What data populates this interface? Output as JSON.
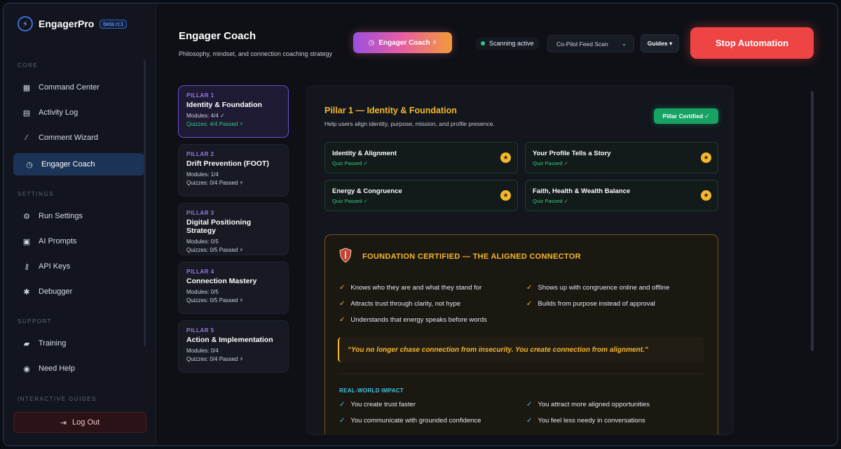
{
  "brand": {
    "name": "EngagerPro",
    "badge": "beta rc1"
  },
  "sidebar": {
    "sections": {
      "core": "CORE",
      "settings": "SETTINGS",
      "support": "SUPPORT",
      "guides": "INTERACTIVE GUIDES"
    },
    "items": [
      {
        "label": "Command Center",
        "icon": "grid-icon"
      },
      {
        "label": "Activity Log",
        "icon": "list-icon"
      },
      {
        "label": "Comment Wizard",
        "icon": "wand-icon"
      },
      {
        "label": "Engager Coach",
        "icon": "clock-icon",
        "active": true
      },
      {
        "label": "Run Settings",
        "icon": "gear-icon"
      },
      {
        "label": "AI Prompts",
        "icon": "chat-icon"
      },
      {
        "label": "API Keys",
        "icon": "key-icon"
      },
      {
        "label": "Debugger",
        "icon": "bug-icon"
      },
      {
        "label": "Training",
        "icon": "book-icon"
      },
      {
        "label": "Need Help",
        "icon": "help-icon"
      }
    ],
    "logout": "Log Out"
  },
  "header": {
    "title": "Engager Coach",
    "subtitle": "Philosophy, mindset, and connection coaching strategy",
    "coach_button": "Engager Coach ⚡",
    "status": "Scanning active",
    "feed_select": "Co-Pilot Feed Scan",
    "guides": "Guides ▾",
    "stop": "Stop Automation"
  },
  "pillars": [
    {
      "label": "PILLAR 1",
      "title": "Identity & Foundation",
      "modules": "Modules: 4/4 ✓",
      "quizzes": "Quizzes: 4/4 Passed ⚡",
      "active": true
    },
    {
      "label": "PILLAR 2",
      "title": "Drift Prevention (FOOT)",
      "modules": "Modules: 1/4",
      "quizzes": "Quizzes: 0/4 Passed ⚡"
    },
    {
      "label": "PILLAR 3",
      "title": "Digital Positioning Strategy",
      "modules": "Modules: 0/5",
      "quizzes": "Quizzes: 0/5 Passed ⚡"
    },
    {
      "label": "PILLAR 4",
      "title": "Connection Mastery",
      "modules": "Modules: 0/5",
      "quizzes": "Quizzes: 0/5 Passed ⚡"
    },
    {
      "label": "PILLAR 5",
      "title": "Action & Implementation",
      "modules": "Modules: 0/4",
      "quizzes": "Quizzes: 0/4 Passed ⚡"
    }
  ],
  "main": {
    "title": "Pillar 1 — Identity & Foundation",
    "subtitle": "Help users align identity, purpose, mission, and profile presence.",
    "badge": "Pillar Certified ✓",
    "quizzes": [
      {
        "title": "Identity & Alignment",
        "status": "Quiz Passed ✓"
      },
      {
        "title": "Your Profile Tells a Story",
        "status": "Quiz Passed ✓"
      },
      {
        "title": "Energy & Congruence",
        "status": "Quiz Passed ✓"
      },
      {
        "title": "Faith, Health & Wealth Balance",
        "status": "Quiz Passed ✓"
      }
    ],
    "foundation": {
      "title": "FOUNDATION CERTIFIED — THE ALIGNED CONNECTOR",
      "traits": [
        "Knows who they are and what they stand for",
        "Shows up with congruence online and offline",
        "Attracts trust through clarity, not hype",
        "Builds from purpose instead of approval",
        "Understands that energy speaks before words"
      ],
      "quote": "“You no longer chase connection from insecurity. You create connection from alignment.”",
      "impact_label": "REAL-WORLD IMPACT",
      "impacts": [
        "You create trust faster",
        "You attract more aligned opportunities",
        "You communicate with grounded confidence",
        "You feel less needy in conversations"
      ]
    }
  }
}
